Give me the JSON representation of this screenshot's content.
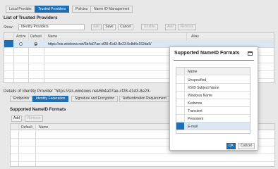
{
  "tabs": [
    "Local Provider",
    "Trusted Providers",
    "Policies",
    "Name ID Management"
  ],
  "trusted": {
    "title": "List of Trusted Providers",
    "show_label": "Show:",
    "show_value": "Identity Providers",
    "buttons": [
      "Edit",
      "Save",
      "Cancel",
      "Enable",
      "Add",
      "Remove"
    ],
    "columns": [
      "Active",
      "Default",
      "Name",
      "Alias"
    ],
    "row_name": "https://sts.windows.net/6b4a07ae-cf28-41d3-8e23-5c8d4c152da5/"
  },
  "details": {
    "title": "Details of Identity Provider \"https://sts.windows.net/6b4a07ae-cf28-41d3-8e23-",
    "subtabs": [
      "Endpoints",
      "Identity Federation",
      "Signature and Encryption",
      "Authentication Requirement"
    ],
    "section_title": "Supported NameID Formats",
    "buttons": [
      "Add",
      "Remove"
    ],
    "columns": [
      "Default",
      "Name"
    ]
  },
  "dialog": {
    "title": "Supported NameID Formats",
    "column": "Name",
    "items": [
      "Unspecified",
      "X509 Subject Name",
      "Windows Name",
      "Kerberos",
      "Transient",
      "Persistent",
      "E-mail"
    ],
    "selected_index": 6,
    "ok": "OK",
    "cancel": "Cancel"
  }
}
